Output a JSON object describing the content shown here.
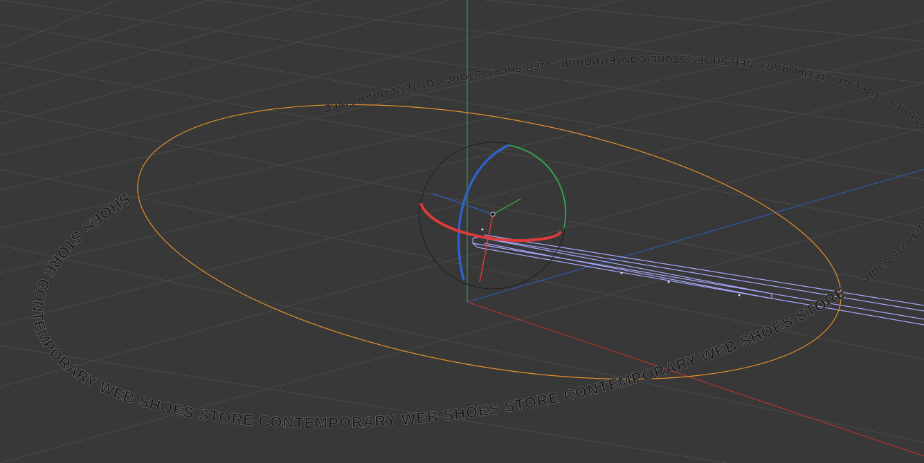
{
  "viewport": {
    "background": "#383838",
    "grid_color": "#4a4a4a",
    "axis_colors": {
      "x": "#c83232",
      "y": "#2fa84f",
      "z": "#2b5fc2"
    }
  },
  "text_ring": {
    "text": "SHOES STORE CONTEMPORARY WEB SHOES STORE CONTEMPORARY WEB SHOES STORE CONTEMPORARY WEB SHOES STORE CONTEMPORARY WEB",
    "spline_color": "#e8922a"
  },
  "rotate_gizmo": {
    "icon": "rotate-gizmo-icon",
    "ring_colors": {
      "x": "#e03a3a",
      "y": "#35a34f",
      "z": "#2f62c7"
    }
  },
  "extruded_object": {
    "wire_color": "#a8a8ff"
  }
}
